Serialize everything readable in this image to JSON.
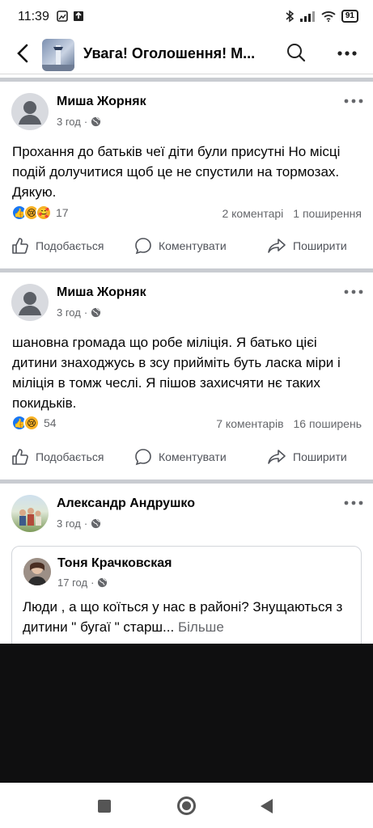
{
  "status_bar": {
    "time": "11:39",
    "battery": "91"
  },
  "header": {
    "title": "Увага! Оголошення! М..."
  },
  "posts": [
    {
      "author": "Миша Жорняк",
      "time": "3 год",
      "text": "Прохання до батьків чеї діти були присутні Но місці подій долучитися щоб це не спустили на тормозах. Дякую.",
      "reaction_count": "17",
      "comments": "2 коментарі",
      "shares": "1 поширення"
    },
    {
      "author": "Миша Жорняк",
      "time": "3 год",
      "text": "шановна громада що робе міліція. Я батько цієі дитини знаходжусь в зсу прийміть буть ласка міри і міліція в томж чеслі. Я пішов захисчяти нє таких покидьків.",
      "reaction_count": "54",
      "comments": "7 коментарів",
      "shares": "16 поширень"
    },
    {
      "author": "Александр Андрушко",
      "time": "3 год",
      "shared": {
        "author": "Тоня Крачковская",
        "time": "17 год",
        "text": "Люди , а що коїться у нас  в районі? Знущаються з дитини \" бугаї \" старш...",
        "more": "Більше"
      }
    }
  ],
  "actions": {
    "like": "Подобається",
    "comment": "Коментувати",
    "share": "Поширити"
  },
  "colors": {
    "like_blue": "#1877f2",
    "sad_yellow": "#f7b125",
    "gray_text": "#65676b",
    "separator": "#c9ccd1"
  }
}
